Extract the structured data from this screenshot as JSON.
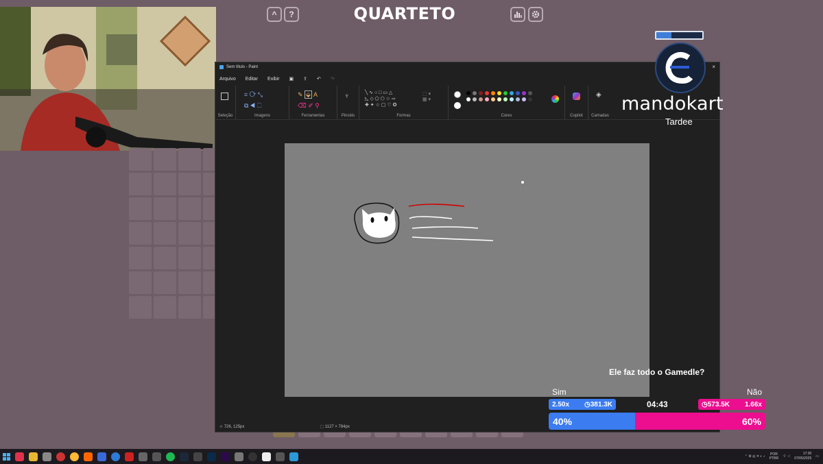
{
  "game": {
    "title": "QUARTETO",
    "help_left": "^",
    "help_right": "?",
    "stats_icon": "bar-chart-icon",
    "settings_icon": "gear-icon"
  },
  "paint": {
    "window_title": "Sem título - Paint",
    "menu": [
      "Arquivo",
      "Editar",
      "Exibir"
    ],
    "ribbon_groups": [
      "Seleção",
      "Imagens",
      "Ferramentas",
      "Pincéis",
      "Formas",
      "Cores",
      "Copilot",
      "Camadas"
    ],
    "status_cursor": "726, 125px",
    "status_canvas": "1127 × 784px"
  },
  "overlay": {
    "brand": "mandokart",
    "subtitle": "Tardee"
  },
  "poll": {
    "question": "Ele faz todo o Gamedle?",
    "option_yes": "Sim",
    "option_no": "Não",
    "yes_multiplier": "2.50x",
    "yes_points": "381.3K",
    "no_points": "573.5K",
    "no_multiplier": "1.66x",
    "timer": "04:43",
    "yes_percent": "40%",
    "no_percent": "60%",
    "yes_share": 0.4,
    "colors": {
      "yes": "#3b7cf0",
      "no": "#ec0e8f"
    }
  },
  "taskbar": {
    "lang": "POR PTBR",
    "time": "17:30",
    "date": "07/05/2025"
  }
}
